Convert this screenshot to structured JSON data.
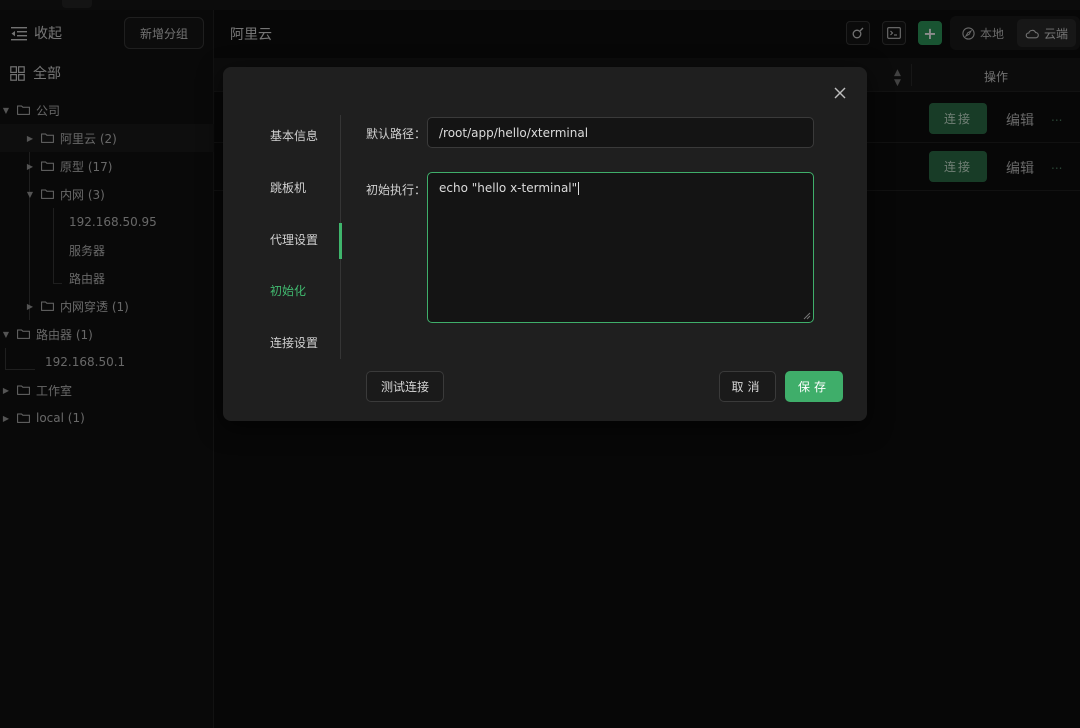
{
  "sidebar": {
    "collapse_label": "收起",
    "new_group_label": "新增分组",
    "all_label": "全部",
    "tree": [
      {
        "label": "公司",
        "level": 0,
        "expanded": true
      },
      {
        "label": "阿里云 (2)",
        "level": 1,
        "expanded": false,
        "selected": true
      },
      {
        "label": "原型 (17)",
        "level": 1,
        "expanded": false
      },
      {
        "label": "内网 (3)",
        "level": 1,
        "expanded": true
      },
      {
        "label": "192.168.50.95",
        "level": 2,
        "leaf": true
      },
      {
        "label": "服务器",
        "level": 2,
        "leaf": true
      },
      {
        "label": "路由器",
        "level": 2,
        "leaf": true
      },
      {
        "label": "内网穿透 (1)",
        "level": 1,
        "expanded": false
      },
      {
        "label": "路由器 (1)",
        "level": 0,
        "expanded": true
      },
      {
        "label": "192.168.50.1",
        "level": 1,
        "leaf": true
      },
      {
        "label": "工作室",
        "level": 0,
        "expanded": false
      },
      {
        "label": "local (1)",
        "level": 0,
        "expanded": false
      }
    ]
  },
  "header": {
    "title": "阿里云",
    "local_label": "本地",
    "cloud_label": "云端"
  },
  "table": {
    "ops_header": "操作",
    "rows": [
      {
        "connect": "连接",
        "edit": "编辑",
        "more": "..."
      },
      {
        "connect": "连接",
        "edit": "编辑",
        "more": "..."
      }
    ]
  },
  "modal": {
    "tabs": [
      "基本信息",
      "跳板机",
      "代理设置",
      "初始化",
      "连接设置"
    ],
    "active_tab": "初始化",
    "default_path_label": "默认路径：",
    "default_path_value": "/root/app/hello/xterminal",
    "init_exec_label": "初始执行：",
    "init_exec_value": "echo \"hello x-terminal\"",
    "test_button": "测试连接",
    "cancel_button": "取消",
    "save_button": "保存"
  },
  "colors": {
    "accent": "#3fae6a",
    "background": "#0d0d0d",
    "modal": "#1f1f1f"
  }
}
